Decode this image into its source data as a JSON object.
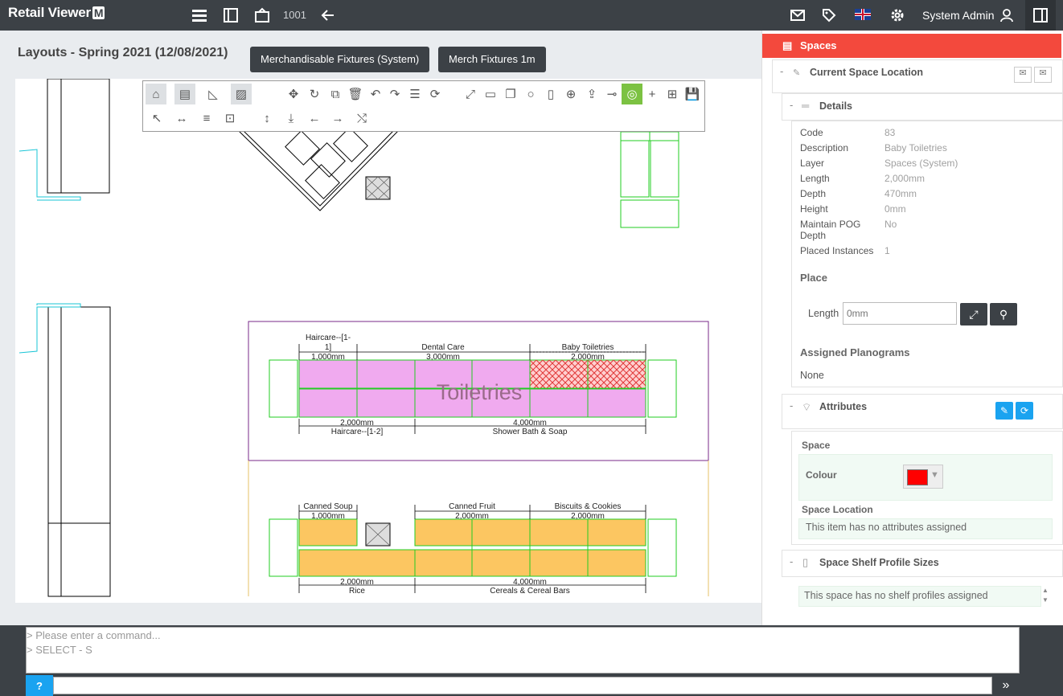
{
  "app": {
    "logo_text": "Retail Viewer",
    "logo_badge": "M"
  },
  "topbar": {
    "counter": "1001",
    "user": "System Admin"
  },
  "page": {
    "title": "Layouts - Spring 2021 (12/08/2021)"
  },
  "header_buttons": [
    "Merchandisable Fixtures (System)",
    "Merch Fixtures 1m"
  ],
  "canvas_labels": {
    "tl_a": "Haircare--[1-",
    "tl_b": "1]",
    "tl_c": "1,000mm",
    "dental": "Dental Care",
    "dental_mm": "3,000mm",
    "baby": "Baby Toiletries",
    "baby_mm": "2,000mm",
    "toiletries": "Toiletries",
    "bl_mm": "2,000mm",
    "bl": "Haircare--[1-2]",
    "shower_mm": "4,000mm",
    "shower": "Shower Bath & Soap",
    "soup": "Canned Soup",
    "soup_mm": "1,000mm",
    "fruit": "Canned Fruit",
    "fruit_mm": "2,000mm",
    "biscuits": "Biscuits & Cookies",
    "biscuits_mm": "2,000mm",
    "rice_mm": "2,000mm",
    "rice": "Rice",
    "cereals_mm": "4,000mm",
    "cereals": "Cereals & Cereal Bars"
  },
  "command": {
    "placeholder": "> Please enter a command...",
    "last": "> SELECT - S",
    "help": "?"
  },
  "panel": {
    "title": "Spaces",
    "current_location": "Current Space Location",
    "details_title": "Details",
    "details": [
      {
        "k": "Code",
        "v": "83"
      },
      {
        "k": "Description",
        "v": "Baby Toiletries"
      },
      {
        "k": "Layer",
        "v": "Spaces (System)"
      },
      {
        "k": "Length",
        "v": "2,000mm"
      },
      {
        "k": "Depth",
        "v": "470mm"
      },
      {
        "k": "Height",
        "v": "0mm"
      },
      {
        "k": "Maintain POG Depth",
        "v": "No"
      },
      {
        "k": "Placed Instances",
        "v": "1"
      }
    ],
    "place_title": "Place",
    "place_length_label": "Length",
    "place_length_placeholder": "0mm",
    "assigned_title": "Assigned Planograms",
    "assigned_value": "None",
    "attributes_title": "Attributes",
    "space_sub": "Space",
    "colour_label": "Colour",
    "colour_value": "#ff0000",
    "space_location_sub": "Space Location",
    "no_attrs": "This item has no attributes assigned",
    "shelf_title": "Space Shelf Profile Sizes",
    "no_shelf": "This space has no shelf profiles assigned"
  }
}
